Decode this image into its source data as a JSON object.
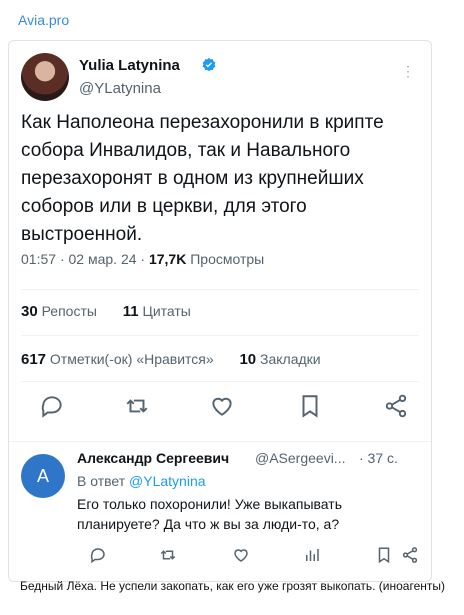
{
  "source": {
    "label": "Avia.pro"
  },
  "tweet": {
    "author_name": "Yulia Latynina",
    "author_handle": "@YLatynina",
    "text": "Как Наполеона перезахоронили в крипте собора Инвалидов, так и Навального перезахоронят в одном из крупнейших соборов или в церкви, для этого выстроенной.",
    "time": "01:57",
    "date": "02 мар. 24",
    "views_count": "17,7K",
    "views_label": "Просмотры",
    "reposts_count": "30",
    "reposts_label": "Репосты",
    "quotes_count": "11",
    "quotes_label": "Цитаты",
    "likes_count": "617",
    "likes_label": "Отметки(-ок) «Нравится»",
    "bookmarks_count": "10",
    "bookmarks_label": "Закладки",
    "accent_color": "#1d9bf0"
  },
  "reply": {
    "avatar_letter": "A",
    "author_name": "Александр Сергеевич",
    "author_handle": "@ASergeevi...",
    "time": "· 37 с.",
    "in_reply_prefix": "В ответ",
    "in_reply_mention": "@YLatynina",
    "text": "Его только похоронили! Уже выкапывать планируете? Да что ж вы за люди-то, а?"
  },
  "caption": {
    "text": "Бедный Лёха. Не успели закопать, как его уже грозят выкопать. (иноагенты)"
  }
}
